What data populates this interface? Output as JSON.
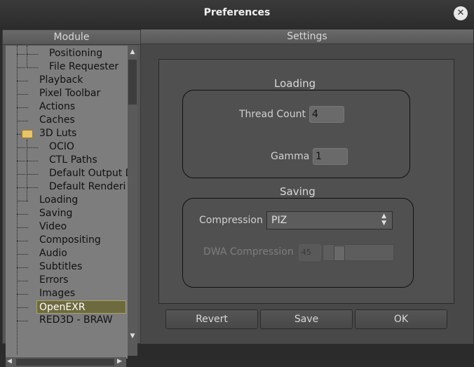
{
  "window": {
    "title": "Preferences",
    "close_icon": "close-icon"
  },
  "module_header": "Module",
  "settings_header": "Settings",
  "tree": {
    "items": [
      {
        "label": "Positioning",
        "level": 2
      },
      {
        "label": "File Requester",
        "level": 2
      },
      {
        "label": "Playback",
        "level": 1
      },
      {
        "label": "Pixel Toolbar",
        "level": 1
      },
      {
        "label": "Actions",
        "level": 1
      },
      {
        "label": "Caches",
        "level": 1
      },
      {
        "label": "3D Luts",
        "level": 1,
        "icon": "folder-open-icon"
      },
      {
        "label": "OCIO",
        "level": 2
      },
      {
        "label": "CTL Paths",
        "level": 2
      },
      {
        "label": "Default Output D",
        "level": 2
      },
      {
        "label": "Default Renderi",
        "level": 2
      },
      {
        "label": "Loading",
        "level": 1
      },
      {
        "label": "Saving",
        "level": 1
      },
      {
        "label": "Video",
        "level": 1
      },
      {
        "label": "Compositing",
        "level": 1
      },
      {
        "label": "Audio",
        "level": 1
      },
      {
        "label": "Subtitles",
        "level": 1
      },
      {
        "label": "Errors",
        "level": 1
      },
      {
        "label": "Images",
        "level": 1
      },
      {
        "label": "OpenEXR",
        "level": 1,
        "selected": true
      },
      {
        "label": "RED3D - BRAW",
        "level": 1
      }
    ]
  },
  "loading": {
    "title": "Loading",
    "thread_count_label": "Thread Count",
    "thread_count": "4",
    "gamma_label": "Gamma",
    "gamma": "1"
  },
  "saving": {
    "title": "Saving",
    "compression_label": "Compression",
    "compression": "PIZ",
    "dwa_label": "DWA Compression",
    "dwa_value": "45"
  },
  "buttons": {
    "revert": "Revert",
    "save": "Save",
    "ok": "OK"
  },
  "colors": {
    "selection": "#6d6a3e",
    "panel": "#505050"
  }
}
